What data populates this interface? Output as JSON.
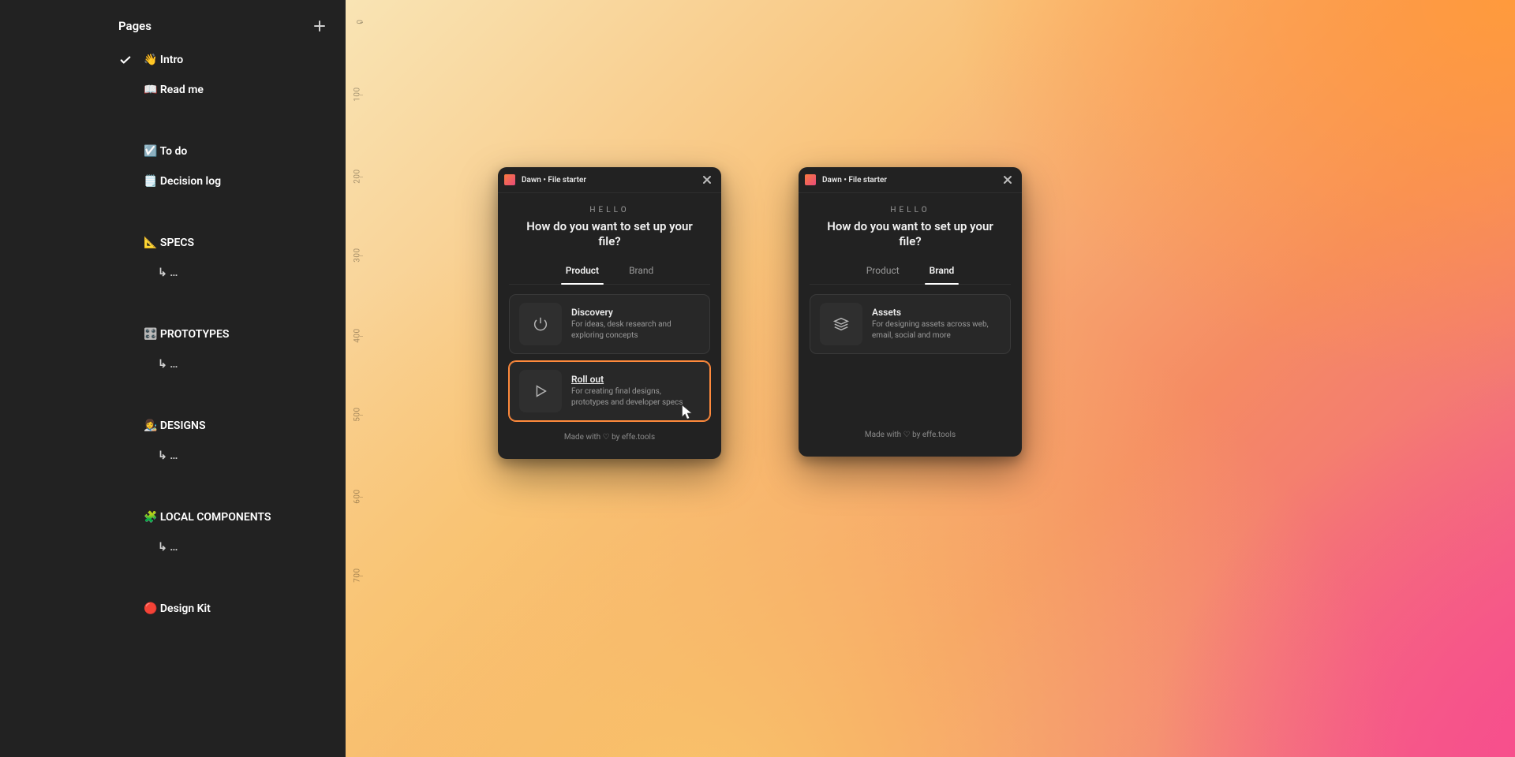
{
  "sidebar": {
    "header": "Pages",
    "pages": [
      {
        "label": "👋 Intro",
        "selected": true
      },
      {
        "label": "📖 Read me",
        "selected": false
      },
      {
        "label": "☑️ To do",
        "selected": false
      },
      {
        "label": "🗒️ Decision log",
        "selected": false
      },
      {
        "label": "📐 SPECS",
        "selected": false
      },
      {
        "label": "↳ …",
        "selected": false,
        "sub": true
      },
      {
        "label": "🎛️ PROTOTYPES",
        "selected": false
      },
      {
        "label": "↳ …",
        "selected": false,
        "sub": true
      },
      {
        "label": "👩‍🎨 DESIGNS",
        "selected": false
      },
      {
        "label": "↳ …",
        "selected": false,
        "sub": true
      },
      {
        "label": "🧩 LOCAL COMPONENTS",
        "selected": false
      },
      {
        "label": "↳ …",
        "selected": false,
        "sub": true
      },
      {
        "label": "🔴 Design Kit",
        "selected": false
      }
    ]
  },
  "ruler_y": [
    "0",
    "100",
    "200",
    "300",
    "400",
    "500",
    "600",
    "700"
  ],
  "modals": [
    {
      "window_title": "Dawn • File starter",
      "hello": "HELLO",
      "question": "How do you want to set up your file?",
      "tabs": {
        "product": "Product",
        "brand": "Brand",
        "active": "product"
      },
      "options": [
        {
          "title": "Discovery",
          "desc": "For ideas, desk research and exploring concepts",
          "icon": "power"
        },
        {
          "title": "Roll out",
          "desc": "For creating final designs, prototypes and developer specs",
          "icon": "play",
          "hover": true
        }
      ],
      "footer": "Made with ♡ by effe.tools"
    },
    {
      "window_title": "Dawn • File starter",
      "hello": "HELLO",
      "question": "How do you want to set up your file?",
      "tabs": {
        "product": "Product",
        "brand": "Brand",
        "active": "brand"
      },
      "options": [
        {
          "title": "Assets",
          "desc": "For designing assets across web, email, social and more",
          "icon": "stack"
        }
      ],
      "footer": "Made with ♡ by effe.tools"
    }
  ]
}
